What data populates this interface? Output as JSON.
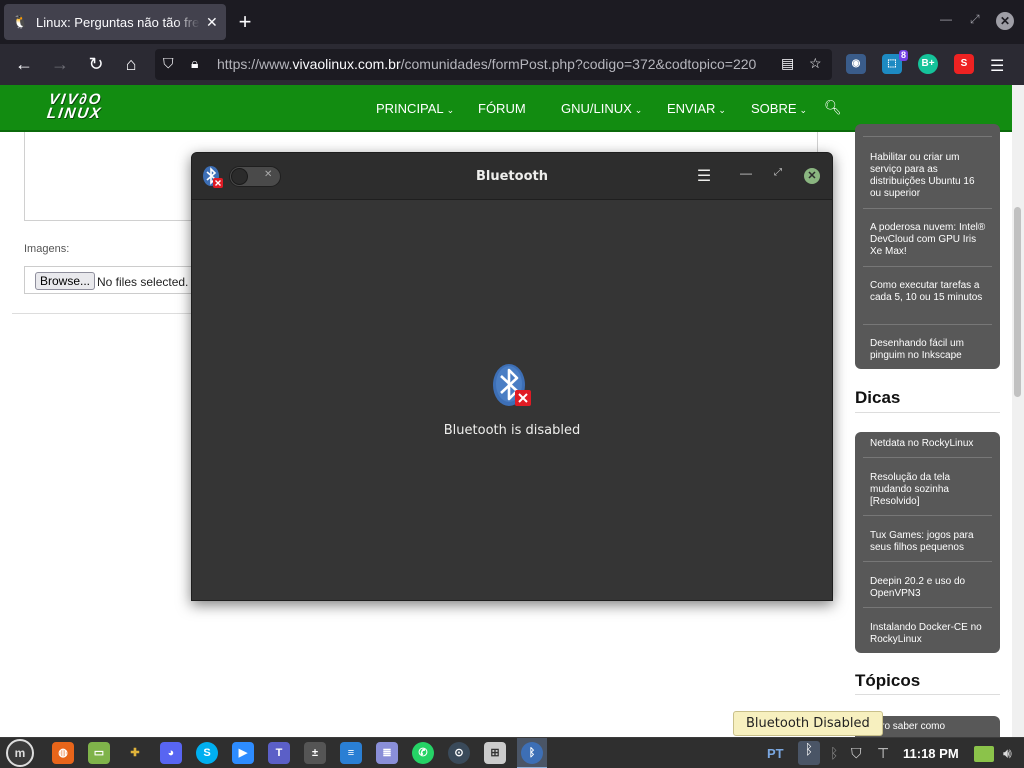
{
  "browser": {
    "tab_title": "Linux: Perguntas não tão frequentes",
    "url_prefix": "https://www.",
    "url_domain": "vivaolinux.com.br",
    "url_path": "/comunidades/formPost.php?codigo=372&codtopico=220",
    "extension_badge": "8",
    "ext_grammarly": "B+",
    "ext_s": "S"
  },
  "site": {
    "logo_line1": "VIV∂O",
    "logo_line2": "LINUX",
    "nav": [
      {
        "label": "PRINCIPAL",
        "has_caret": true
      },
      {
        "label": "FÓRUM",
        "has_caret": false
      },
      {
        "label": "GNU/LINUX",
        "has_caret": true
      },
      {
        "label": "ENVIAR",
        "has_caret": true
      },
      {
        "label": "SOBRE",
        "has_caret": true
      }
    ],
    "caret": "⌄"
  },
  "form": {
    "imagens_label": "Imagens:",
    "browse_label": "Browse...",
    "no_files_text": "No files selected."
  },
  "sidebar": {
    "articles": [
      "Habilitar ou criar um serviço para as distribuições Ubuntu 16 ou superior",
      "A poderosa nuvem: Intel® DevCloud com GPU Iris Xe Max!",
      "Como executar tarefas a cada 5, 10 ou 15 minutos",
      "Desenhando fácil um pinguim no Inkscape"
    ],
    "dicas_title": "Dicas",
    "dicas": [
      "Netdata no RockyLinux",
      "Resolução da tela mudando sozinha [Resolvido]",
      "Tux Games: jogos para seus filhos pequenos",
      "Deepin 20.2 e uso do OpenVPN3",
      "Instalando Docker-CE no RockyLinux"
    ],
    "topicos_title": "Tópicos",
    "topicos_first": "uero saber como"
  },
  "bluetooth": {
    "title": "Bluetooth",
    "status": "Bluetooth is disabled",
    "enabled": false
  },
  "taskbar": {
    "lang": "PT",
    "clock": "11:18 PM",
    "tooltip": "Bluetooth Disabled"
  },
  "colors": {
    "site_green": "#128c11",
    "bt_blue": "#3d6fb6",
    "bt_error": "#e01b24"
  }
}
